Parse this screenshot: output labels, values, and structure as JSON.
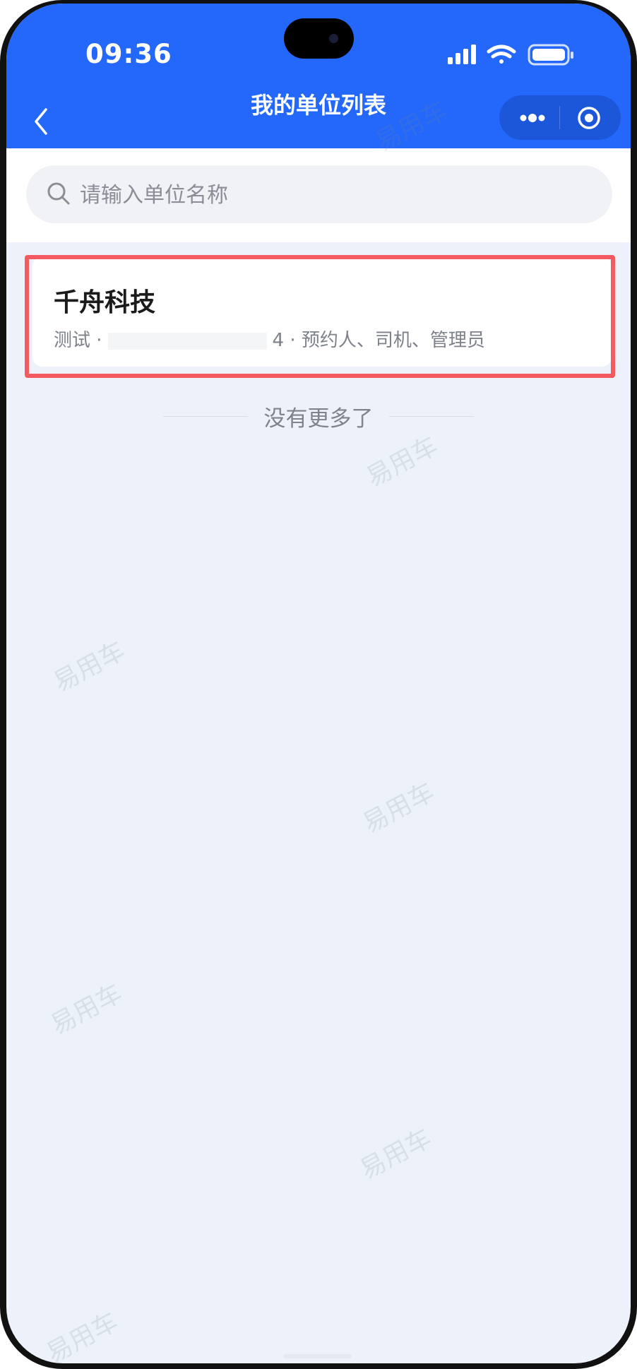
{
  "status_bar": {
    "time": "09:36",
    "icons": [
      "cellular-signal-icon",
      "wifi-icon",
      "battery-icon"
    ]
  },
  "nav": {
    "title": "我的单位列表",
    "back_icon": "chevron-left-icon",
    "more_icon": "more-dots-icon",
    "close_icon": "target-circle-icon"
  },
  "search": {
    "placeholder": "请输入单位名称",
    "value": ""
  },
  "units": [
    {
      "name": "千舟科技",
      "meta_prefix": "测试 ·",
      "meta_phone_suffix": "4",
      "meta_roles": "· 预约人、司机、管理员"
    }
  ],
  "list_end_text": "没有更多了",
  "watermark_text": "易用车",
  "colors": {
    "header_blue": "#2468fb",
    "page_bg": "#edf2fa",
    "highlight_red": "#f45a5f"
  }
}
